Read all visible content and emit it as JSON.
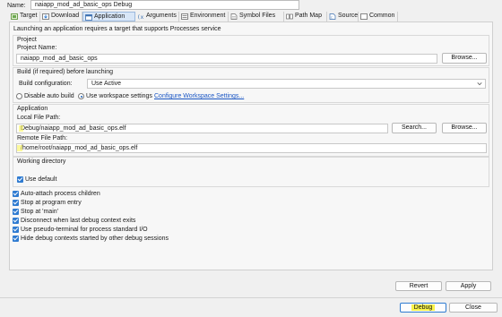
{
  "header": {
    "name_label": "Name:",
    "name_value": "naiapp_mod_ad_basic_ops Debug"
  },
  "tabs": [
    {
      "label": "Target",
      "icon": "target-icon"
    },
    {
      "label": "Download",
      "icon": "download-icon"
    },
    {
      "label": "Application",
      "icon": "application-icon"
    },
    {
      "label": "Arguments",
      "icon": "arguments-icon"
    },
    {
      "label": "Environment",
      "icon": "environment-icon"
    },
    {
      "label": "Symbol Files",
      "icon": "symbol-files-icon"
    },
    {
      "label": "Path Map",
      "icon": "path-map-icon"
    },
    {
      "label": "Source",
      "icon": "source-icon"
    },
    {
      "label": "Common",
      "icon": "common-icon"
    }
  ],
  "info_text": "Launching an application requires a target that supports Processes service",
  "project": {
    "title": "Project",
    "name_label": "Project Name:",
    "name_value": "naiapp_mod_ad_basic_ops",
    "browse_label": "Browse..."
  },
  "build": {
    "title": "Build (if required) before launching",
    "config_label": "Build configuration:",
    "config_value": "Use Active",
    "disable_auto_label": "Disable auto build",
    "workspace_label": "Use workspace settings",
    "configure_link": "Configure Workspace Settings..."
  },
  "application": {
    "title": "Application",
    "local_label": "Local File Path:",
    "local_value": "Debug/naiapp_mod_ad_basic_ops.elf",
    "search_label": "Search...",
    "browse_label": "Browse...",
    "remote_label": "Remote File Path:",
    "remote_value": "/home/root/naiapp_mod_ad_basic_ops.elf"
  },
  "working_directory": {
    "title": "Working directory",
    "use_default_label": "Use default"
  },
  "options": [
    "Auto-attach process children",
    "Stop at program entry",
    "Stop at 'main'",
    "Disconnect when last debug context exits",
    "Use pseudo-terminal for process standard I/O",
    "Hide debug contexts started by other debug sessions"
  ],
  "buttons": {
    "revert": "Revert",
    "apply": "Apply",
    "debug": "Debug",
    "close": "Close"
  },
  "colors": {
    "accent": "#2f7bd1",
    "link": "#1a56c4",
    "highlight": "#f7f34a"
  }
}
